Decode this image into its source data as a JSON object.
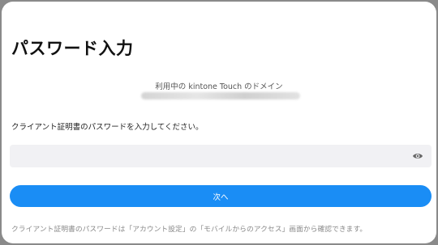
{
  "page": {
    "title": "パスワード入力"
  },
  "domain": {
    "label": "利用中の kintone Touch のドメイン"
  },
  "form": {
    "instruction": "クライアント証明書のパスワードを入力してください。",
    "password_value": "",
    "password_icon": "eye-icon",
    "next_label": "次へ"
  },
  "footer": {
    "note": "クライアント証明書のパスワードは「アカウント設定」の「モバイルからのアクセス」画面から確認できます。"
  },
  "colors": {
    "accent": "#1a8df5",
    "field_background": "#f1f1f4",
    "muted_text": "#8a8a8a"
  }
}
